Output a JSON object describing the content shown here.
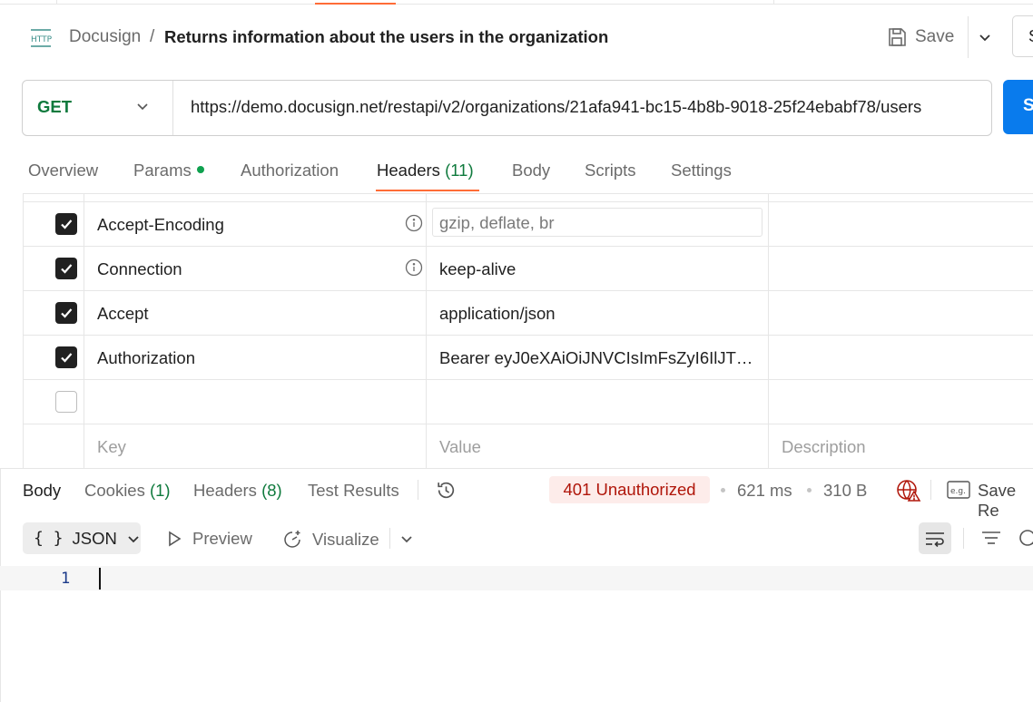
{
  "breadcrumb": {
    "protocol_icon": "http-icon",
    "parent": "Docusign",
    "separator": "/",
    "title": "Returns information about the users in the organization"
  },
  "toolbar": {
    "save_label": "Save",
    "share_label": "S"
  },
  "request": {
    "method": "GET",
    "url": "https://demo.docusign.net/restapi/v2/organizations/21afa941-bc15-4b8b-9018-25f24ebabf78/users",
    "send_label": "S"
  },
  "request_tabs": {
    "overview": "Overview",
    "params": "Params",
    "authorization": "Authorization",
    "headers": "Headers",
    "headers_count": "(11)",
    "body": "Body",
    "scripts": "Scripts",
    "settings": "Settings",
    "active": "Headers"
  },
  "headers_table": {
    "rows": [
      {
        "checked": true,
        "key": "Accept-Encoding",
        "value": "gzip, deflate, br",
        "info": true
      },
      {
        "checked": true,
        "key": "Connection",
        "value": "keep-alive",
        "info": true
      },
      {
        "checked": true,
        "key": "Accept",
        "value": "application/json",
        "info": false
      },
      {
        "checked": true,
        "key": "Authorization",
        "value": "Bearer eyJ0eXAiOiJNVCIsImFsZyI6IlJT…",
        "info": false
      },
      {
        "checked": false,
        "key": "",
        "value": "",
        "info": false
      }
    ],
    "placeholders": {
      "key": "Key",
      "value": "Value",
      "description": "Description"
    }
  },
  "response": {
    "tabs": {
      "body": "Body",
      "cookies": "Cookies",
      "cookies_count": "(1)",
      "headers": "Headers",
      "headers_count": "(8)",
      "test_results": "Test Results"
    },
    "status": "401 Unauthorized",
    "time": "621 ms",
    "size": "310 B",
    "save_response": "Save Re",
    "format": "JSON",
    "format_icon_text": "{ }",
    "preview": "Preview",
    "visualize": "Visualize",
    "line_number": "1"
  },
  "colors": {
    "accent": "#ff6c37",
    "method_get": "#0f7a3d",
    "send": "#097bed",
    "error_bg": "#fdecea",
    "error_text": "#b0160a"
  }
}
